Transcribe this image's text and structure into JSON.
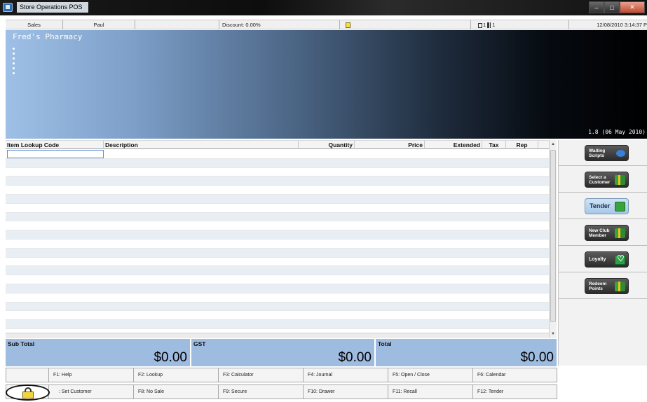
{
  "window": {
    "title": "Store Operations POS"
  },
  "status_bar": {
    "mode": "Sales",
    "cashier": "Paul",
    "blank": "",
    "discount": "Discount: 0.00%",
    "register": "1",
    "register2": "1",
    "datetime": "12/08/2010 3:14:37 P"
  },
  "banner": {
    "store_name": "Fred's Pharmacy",
    "version": "1.8 (06 May 2010)"
  },
  "grid": {
    "columns": [
      "Item Lookup Code",
      "Description",
      "Quantity",
      "Price",
      "Extended",
      "Tax",
      "Rep"
    ],
    "row_count": 20
  },
  "side_buttons": [
    {
      "line1": "Waiting",
      "line2": "Scripts",
      "icon": "pill-icon"
    },
    {
      "line1": "Select a",
      "line2": "Customer",
      "icon": "customer-icon"
    },
    {
      "line1": "Tender",
      "line2": "",
      "icon": "cash-icon"
    },
    {
      "line1": "New Club",
      "line2": "Member",
      "icon": "member-icon"
    },
    {
      "line1": "Loyalty",
      "line2": "",
      "icon": "heart-icon"
    },
    {
      "line1": "Redeem",
      "line2": "Points",
      "icon": "points-icon"
    }
  ],
  "totals": {
    "subtotal_label": "Sub Total",
    "subtotal_value": "$0.00",
    "gst_label": "GST",
    "gst_value": "$0.00",
    "total_label": "Total",
    "total_value": "$0.00"
  },
  "function_keys": {
    "row1": [
      "",
      "F1: Help",
      "F2: Lookup",
      "F3: Calculator",
      "F4: Journal",
      "F5: Open / Close",
      "F6: Calendar"
    ],
    "row2": [
      "",
      ": Set Customer",
      "F8: No Sale",
      "F9: Secure",
      "F10: Drawer",
      "F11: Recall",
      "F12: Tender"
    ]
  },
  "colors": {
    "accent_blue": "#9ebbe0",
    "grid_alt_row": "#e9eef5",
    "lock_yellow": "#f2d53c"
  }
}
